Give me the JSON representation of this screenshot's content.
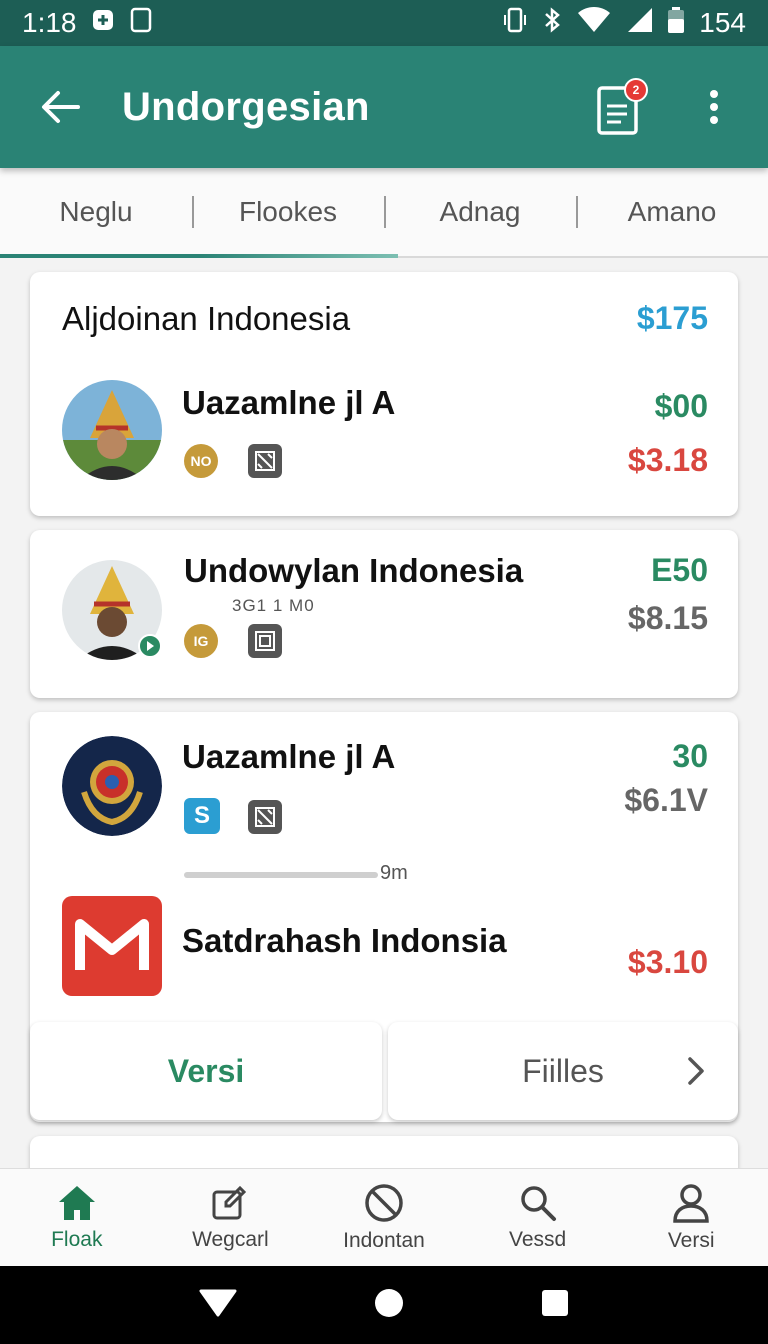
{
  "status_bar": {
    "time": "1:18",
    "battery": "154"
  },
  "app_bar": {
    "title": "Undorgesian",
    "badge": "2"
  },
  "tabs": [
    {
      "label": "Neglu"
    },
    {
      "label": "Flookes"
    },
    {
      "label": "Adnag"
    },
    {
      "label": "Amano"
    }
  ],
  "cards": [
    {
      "title": "Aljdoinan Indonesia",
      "title_price": "$175",
      "name": "Uazamlne jl A",
      "chip": "NO",
      "price_1": "$00",
      "price_2": "$3.18"
    },
    {
      "name": "Undowylan Indonesia",
      "sub": "3G1 1 M0",
      "chip": "IG",
      "price_1": "E50",
      "price_2": "$8.15"
    },
    {
      "name": "Uazamlne jl A",
      "price_1": "30",
      "price_2": "$6.1V",
      "progress_label": "9m",
      "item2_name": "Satdrahash Indonsia",
      "item2_price": "$3.10",
      "button_left": "Versi",
      "button_right": "Fiilles"
    }
  ],
  "bottom_nav": [
    {
      "label": "Floak",
      "icon": "home-icon",
      "active": true
    },
    {
      "label": "Wegcarl",
      "icon": "edit-box-icon",
      "active": false
    },
    {
      "label": "Indontan",
      "icon": "block-icon",
      "active": false
    },
    {
      "label": "Vessd",
      "icon": "search-icon",
      "active": false
    },
    {
      "label": "Versi",
      "icon": "person-icon",
      "active": false
    }
  ],
  "colors": {
    "primary": "#2a8375",
    "status_bar": "#1d5e55",
    "price_blue": "#2b9ed2",
    "price_green": "#2a8a62",
    "price_red": "#d9473f",
    "badge_red": "#e53935"
  }
}
